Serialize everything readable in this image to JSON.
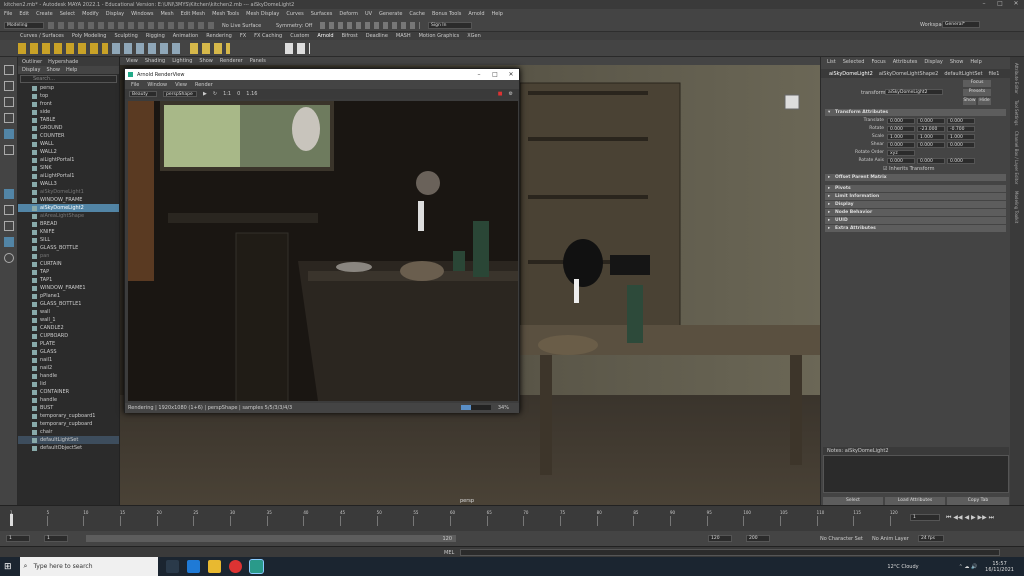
{
  "window": {
    "title": "kitchen2.mb* - Autodesk MAYA 2022.1 - Educational Version: E:\\UNI\\3MYS\\Kitchen\\kitchen2.mb  ---  aiSkyDomeLight2"
  },
  "menubar": [
    "File",
    "Edit",
    "Create",
    "Select",
    "Modify",
    "Display",
    "Windows",
    "Mesh",
    "Edit Mesh",
    "Mesh Tools",
    "Mesh Display",
    "Curves",
    "Surfaces",
    "Deform",
    "UV",
    "Generate",
    "Cache",
    "Bonus Tools",
    "Arnold",
    "Help"
  ],
  "workspace": {
    "label": "Workspace:",
    "value": "General*"
  },
  "statusline": {
    "mode": "Modeling",
    "no_live": "No Live Surface",
    "symmetry": "Symmetry: Off",
    "signin": "Sign In"
  },
  "shelf_tabs": [
    "Curves / Surfaces",
    "Poly Modeling",
    "Sculpting",
    "Rigging",
    "Animation",
    "Rendering",
    "FX",
    "FX Caching",
    "Custom",
    "Arnold",
    "Bifrost",
    "Deadline",
    "MASH",
    "Motion Graphics",
    "XGen"
  ],
  "outliner": {
    "tabs": [
      "Outliner",
      "Hypershade"
    ],
    "menu": [
      "Display",
      "Show",
      "Help"
    ],
    "search_placeholder": "Search...",
    "items": [
      {
        "label": "persp",
        "state": "normal"
      },
      {
        "label": "top",
        "state": "normal"
      },
      {
        "label": "front",
        "state": "normal"
      },
      {
        "label": "side",
        "state": "normal"
      },
      {
        "label": "TABLE",
        "state": "normal"
      },
      {
        "label": "GROUND",
        "state": "normal"
      },
      {
        "label": "COUNTER",
        "state": "normal"
      },
      {
        "label": "WALL",
        "state": "normal"
      },
      {
        "label": "WALL2",
        "state": "normal"
      },
      {
        "label": "aiLightPortal1",
        "state": "normal"
      },
      {
        "label": "SINK",
        "state": "normal"
      },
      {
        "label": "aiLightPortal1",
        "state": "normal"
      },
      {
        "label": "WALL3",
        "state": "normal"
      },
      {
        "label": "aiSkyDomeLight1",
        "state": "dim"
      },
      {
        "label": "WINDOW_FRAME",
        "state": "normal"
      },
      {
        "label": "aiSkyDomeLight2",
        "state": "sel"
      },
      {
        "label": "aiAreaLightShape",
        "state": "dim"
      },
      {
        "label": "BREAD",
        "state": "normal"
      },
      {
        "label": "KNIFE",
        "state": "normal"
      },
      {
        "label": "SILL",
        "state": "normal"
      },
      {
        "label": "GLASS_BOTTLE",
        "state": "normal"
      },
      {
        "label": "pan",
        "state": "dim"
      },
      {
        "label": "CURTAIN",
        "state": "normal"
      },
      {
        "label": "TAP",
        "state": "normal"
      },
      {
        "label": "TAP1",
        "state": "normal"
      },
      {
        "label": "WINDOW_FRAME1",
        "state": "normal"
      },
      {
        "label": "pPlane1",
        "state": "normal"
      },
      {
        "label": "GLASS_BOTTLE1",
        "state": "normal"
      },
      {
        "label": "wall",
        "state": "normal"
      },
      {
        "label": "wall_1",
        "state": "normal"
      },
      {
        "label": "CANDLE2",
        "state": "normal"
      },
      {
        "label": "CUPBOARD",
        "state": "normal"
      },
      {
        "label": "PLATE",
        "state": "normal"
      },
      {
        "label": "GLASS",
        "state": "normal"
      },
      {
        "label": "nail1",
        "state": "normal"
      },
      {
        "label": "nail2",
        "state": "normal"
      },
      {
        "label": "handle",
        "state": "normal"
      },
      {
        "label": "lid",
        "state": "normal"
      },
      {
        "label": "CONTAINER",
        "state": "normal"
      },
      {
        "label": "handle",
        "state": "normal"
      },
      {
        "label": "BUST",
        "state": "normal"
      },
      {
        "label": "temporary_cupboard1",
        "state": "normal"
      },
      {
        "label": "temporary_cupboard",
        "state": "normal"
      },
      {
        "label": "chair",
        "state": "normal"
      },
      {
        "label": "defaultLightSet",
        "state": "hl"
      },
      {
        "label": "defaultObjectSet",
        "state": "normal"
      }
    ]
  },
  "viewport": {
    "menu": [
      "View",
      "Shading",
      "Lighting",
      "Show",
      "Renderer",
      "Panels"
    ],
    "camera_label": "persp"
  },
  "renderview": {
    "title": "Arnold RenderView",
    "menu": [
      "File",
      "Window",
      "View",
      "Render"
    ],
    "display": "Beauty",
    "camera": "perspShape",
    "ratio": "1:1",
    "exposure": "0",
    "gamma": "1.16",
    "status": "Rendering | 1920x1080 (1+6) | perspShape | samples 5/5/3/3/4/3",
    "progress_pct": 34,
    "progress_label": "34%"
  },
  "attr_editor": {
    "menu": [
      "List",
      "Selected",
      "Focus",
      "Attributes",
      "Display",
      "Show",
      "Help"
    ],
    "tabs": [
      "aiSkyDomeLight2",
      "aiSkyDomeLightShape2",
      "defaultLightSet",
      "file1"
    ],
    "transform_label": "transform:",
    "transform_value": "aiSkyDomeLight2",
    "buttons": [
      "Focus",
      "Presets",
      "Show",
      "Hide"
    ],
    "section_open": "Transform Attributes",
    "rows": [
      {
        "label": "Translate",
        "v": [
          "0.000",
          "0.000",
          "0.000"
        ]
      },
      {
        "label": "Rotate",
        "v": [
          "0.000",
          "-23.000",
          "-0.700"
        ]
      },
      {
        "label": "Scale",
        "v": [
          "1.000",
          "1.000",
          "1.000"
        ]
      },
      {
        "label": "Shear",
        "v": [
          "0.000",
          "0.000",
          "0.000"
        ]
      },
      {
        "label": "Rotate Order",
        "v": [
          "xyz"
        ]
      },
      {
        "label": "Rotate Axis",
        "v": [
          "0.000",
          "0.000",
          "0.000"
        ]
      }
    ],
    "inherits": "Inherits Transform",
    "offset_matrix": "Offset Parent Matrix",
    "sections": [
      "Pivots",
      "Limit Information",
      "Display",
      "Node Behavior",
      "UUID",
      "Extra Attributes"
    ],
    "notes_label": "Notes: aiSkyDomeLight2",
    "bottom_buttons": [
      "Select",
      "Load Attributes",
      "Copy Tab"
    ]
  },
  "sidetabs": [
    "Attribute Editor",
    "Tool Settings",
    "Channel Box / Layer Editor",
    "Modeling Toolkit"
  ],
  "timeslider": {
    "ticks": [
      "1",
      "5",
      "10",
      "15",
      "20",
      "25",
      "30",
      "35",
      "40",
      "45",
      "50",
      "55",
      "60",
      "65",
      "70",
      "75",
      "80",
      "85",
      "90",
      "95",
      "100",
      "105",
      "110",
      "115",
      "120"
    ],
    "current_frame": "1"
  },
  "range": {
    "start": "1",
    "start2": "1",
    "mid": "120",
    "end1": "120",
    "end2": "200",
    "character": "No Character Set",
    "anim_layer": "No Anim Layer",
    "fps": "24 fps"
  },
  "cmdline": {
    "mel": "MEL"
  },
  "taskbar": {
    "search": "Type here to search",
    "weather": "12°C  Cloudy",
    "time": "15:57",
    "date": "16/11/2021"
  },
  "colors": {
    "accent": "#5285a6",
    "progress": "#5a8fc7"
  }
}
